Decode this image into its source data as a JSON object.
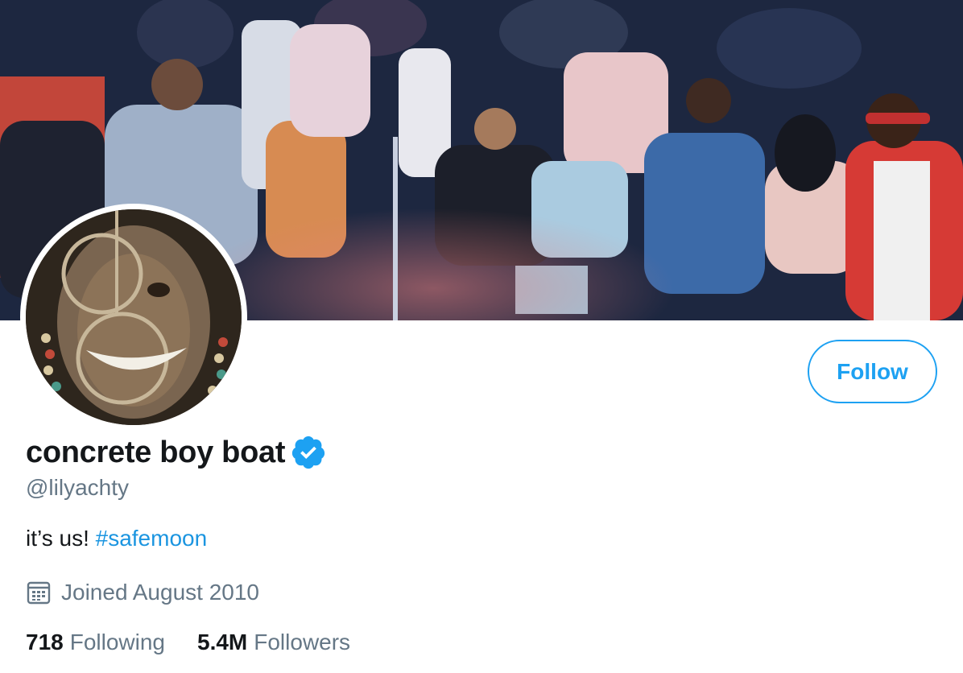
{
  "banner": {
    "image": "party-crowd-photo"
  },
  "avatar": {
    "image": "profile-photo"
  },
  "follow_button": {
    "label": "Follow"
  },
  "profile": {
    "display_name": "concrete boy boat",
    "verified": true,
    "handle": "@lilyachty",
    "bio_text": "it’s us! ",
    "bio_hashtag": "#safemoon",
    "joined": "Joined August 2010"
  },
  "stats": {
    "following_count": "718",
    "following_label": "Following",
    "followers_count": "5.4M",
    "followers_label": "Followers"
  },
  "icons": {
    "verified": "verified-badge-icon",
    "calendar": "calendar-icon"
  },
  "colors": {
    "accent": "#1da1f2",
    "link": "#1b95e0",
    "text": "#14171a",
    "secondary_text": "#657786"
  }
}
